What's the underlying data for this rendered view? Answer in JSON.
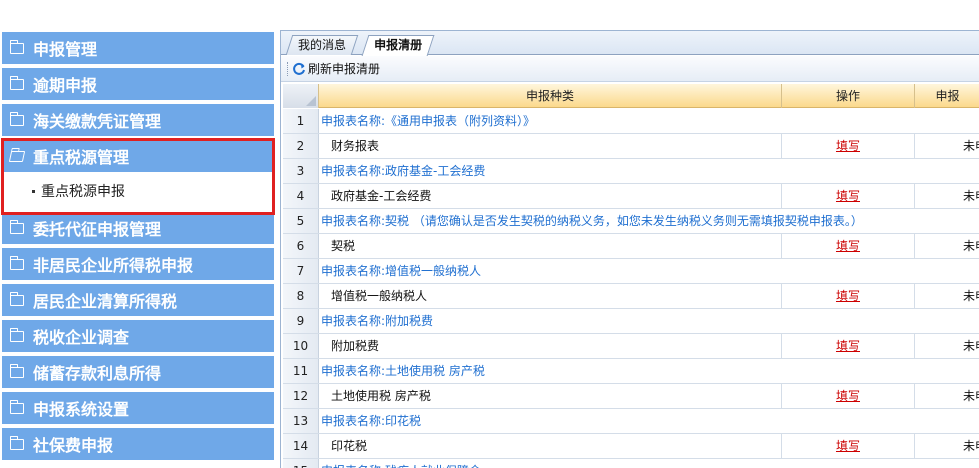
{
  "sidebar": {
    "items": [
      {
        "label": "申报管理"
      },
      {
        "label": "逾期申报"
      },
      {
        "label": "海关缴款凭证管理"
      },
      {
        "label": "重点税源管理"
      },
      {
        "label": "委托代征申报管理"
      },
      {
        "label": "非居民企业所得税申报"
      },
      {
        "label": "居民企业清算所得税"
      },
      {
        "label": "税收企业调查"
      },
      {
        "label": "储蓄存款利息所得"
      },
      {
        "label": "申报系统设置"
      },
      {
        "label": "社保费申报"
      }
    ],
    "active_index": 3,
    "submenu_label": "重点税源申报"
  },
  "tabs": [
    {
      "label": "我的消息"
    },
    {
      "label": "申报清册"
    }
  ],
  "active_tab": 1,
  "toolbar": {
    "refresh_label": "刷新申报清册"
  },
  "grid": {
    "headers": {
      "type": "申报种类",
      "operation": "操作",
      "status": "申报"
    },
    "rows": [
      {
        "num": "1",
        "kind": "group",
        "text": "申报表名称:《通用申报表（附列资料）》"
      },
      {
        "num": "2",
        "kind": "item",
        "text": "财务报表",
        "op": "填写",
        "status": "未申"
      },
      {
        "num": "3",
        "kind": "group",
        "text": "申报表名称:政府基金-工会经费"
      },
      {
        "num": "4",
        "kind": "item",
        "text": "政府基金-工会经费",
        "op": "填写",
        "status": "未申"
      },
      {
        "num": "5",
        "kind": "group",
        "text": "申报表名称:契税 （请您确认是否发生契税的纳税义务，如您未发生纳税义务则无需填报契税申报表。）"
      },
      {
        "num": "6",
        "kind": "item",
        "text": "契税",
        "op": "填写",
        "status": "未申"
      },
      {
        "num": "7",
        "kind": "group",
        "text": "申报表名称:增值税一般纳税人"
      },
      {
        "num": "8",
        "kind": "item",
        "text": "增值税一般纳税人",
        "op": "填写",
        "status": "未申"
      },
      {
        "num": "9",
        "kind": "group",
        "text": "申报表名称:附加税费"
      },
      {
        "num": "10",
        "kind": "item",
        "text": "附加税费",
        "op": "填写",
        "status": "未申"
      },
      {
        "num": "11",
        "kind": "group",
        "text": "申报表名称:土地使用税 房产税"
      },
      {
        "num": "12",
        "kind": "item",
        "text": "土地使用税 房产税",
        "op": "填写",
        "status": "未申"
      },
      {
        "num": "13",
        "kind": "group",
        "text": "申报表名称:印花税"
      },
      {
        "num": "14",
        "kind": "item",
        "text": "印花税",
        "op": "填写",
        "status": "未申"
      },
      {
        "num": "15",
        "kind": "group",
        "text": "申报表名称:残疾人就业保障金"
      }
    ]
  },
  "colors": {
    "sidebar_bg": "#6fa8e8",
    "highlight": "#e02020",
    "link": "#cc0000",
    "group_text": "#1f6fd0",
    "header_bg": "#fbd98c"
  }
}
